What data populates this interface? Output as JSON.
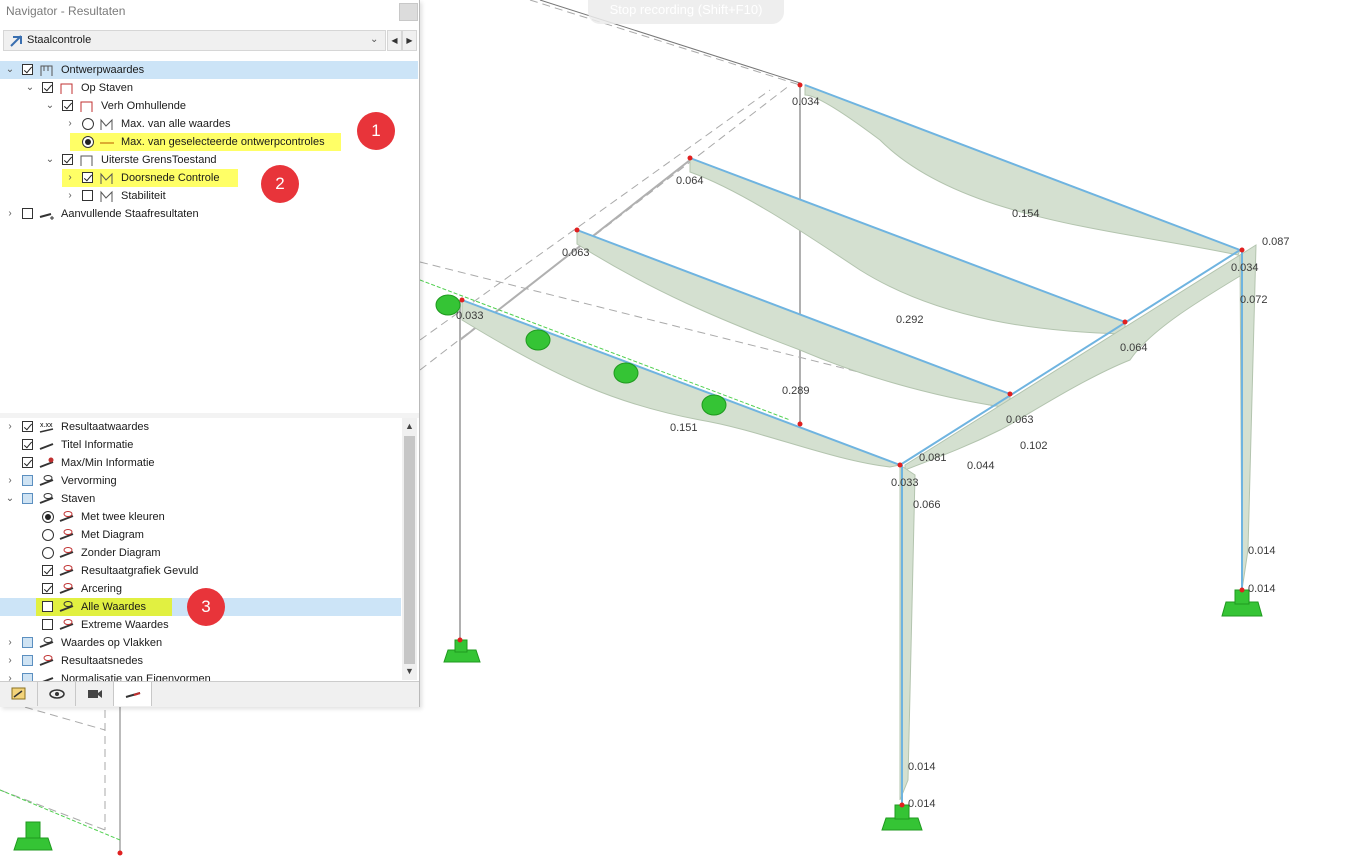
{
  "viewport": {
    "recording_hint": "Stop recording (Shift+F10)",
    "value_labels": [
      "0.034",
      "0.064",
      "0.154",
      "0.087",
      "0.034",
      "0.072",
      "0.063",
      "0.292",
      "0.064",
      "0.033",
      "0.289",
      "0.063",
      "0.151",
      "0.102",
      "0.081",
      "0.044",
      "0.033",
      "0.066",
      "0.014",
      "0.014",
      "0.014",
      "0.014"
    ],
    "colors": {
      "diagram_fill": "#d4e0d0",
      "member": "#6fb4e0",
      "support": "#35c435",
      "line": "#9a9a9a",
      "node": "#e02020"
    }
  },
  "navigator": {
    "title": "Navigator - Resultaten",
    "module_select": {
      "value": "Staalcontrole",
      "icon": "steel-design-icon"
    },
    "tree": [
      {
        "label": "Ontwerpwaardes",
        "icon": "design-values-icon",
        "checked": true,
        "expanded": true
      },
      {
        "label": "Op Staven",
        "icon": "members-icon",
        "checked": true,
        "expanded": true
      },
      {
        "label": "Verh Omhullende",
        "icon": "envelope-icon",
        "checked": true,
        "expanded": true
      },
      {
        "label": "Max. van alle waardes",
        "icon": "max-icon",
        "radio": "off"
      },
      {
        "label": "Max. van geselecteerde ontwerpcontroles",
        "icon": "line-icon",
        "radio": "on"
      },
      {
        "label": "Uiterste GrensToestand",
        "icon": "uls-icon",
        "checked": true,
        "expanded": true
      },
      {
        "label": "Doorsnede Controle",
        "icon": "section-check-icon",
        "checked": true
      },
      {
        "label": "Stabiliteit",
        "icon": "stability-icon",
        "checked": false
      },
      {
        "label": "Aanvullende Staafresultaten",
        "icon": "additional-results-icon",
        "checked": false
      }
    ],
    "display_options": [
      {
        "label": "Resultaatwaardes",
        "icon": "result-values-icon",
        "state": "checked"
      },
      {
        "label": "Titel Informatie",
        "icon": "title-info-icon",
        "state": "checked"
      },
      {
        "label": "Max/Min Informatie",
        "icon": "maxmin-info-icon",
        "state": "checked"
      },
      {
        "label": "Vervorming",
        "icon": "deformation-icon",
        "state": "partial"
      },
      {
        "label": "Staven",
        "icon": "members-display-icon",
        "state": "partial"
      },
      {
        "label": "Met twee kleuren",
        "icon": "two-colors-icon",
        "radio": "on"
      },
      {
        "label": "Met Diagram",
        "icon": "with-diagram-icon",
        "radio": "off"
      },
      {
        "label": "Zonder Diagram",
        "icon": "without-diagram-icon",
        "radio": "off"
      },
      {
        "label": "Resultaatgrafiek Gevuld",
        "icon": "filled-diagram-icon",
        "state": "checked"
      },
      {
        "label": "Arcering",
        "icon": "hatching-icon",
        "state": "checked"
      },
      {
        "label": "Alle Waardes",
        "icon": "all-values-icon",
        "state": "unchecked"
      },
      {
        "label": "Extreme Waardes",
        "icon": "extreme-values-icon",
        "state": "unchecked"
      },
      {
        "label": "Waardes op Vlakken",
        "icon": "surface-values-icon",
        "state": "partial"
      },
      {
        "label": "Resultaatsnedes",
        "icon": "result-sections-icon",
        "state": "partial"
      },
      {
        "label": "Normalisatie van Eigenvormen",
        "icon": "normalization-icon",
        "state": "partial"
      }
    ],
    "badges": [
      "1",
      "2",
      "3"
    ],
    "bottom_tabs": [
      "data-tab-icon",
      "view-tab-icon",
      "camera-tab-icon",
      "results-tab-icon"
    ]
  }
}
